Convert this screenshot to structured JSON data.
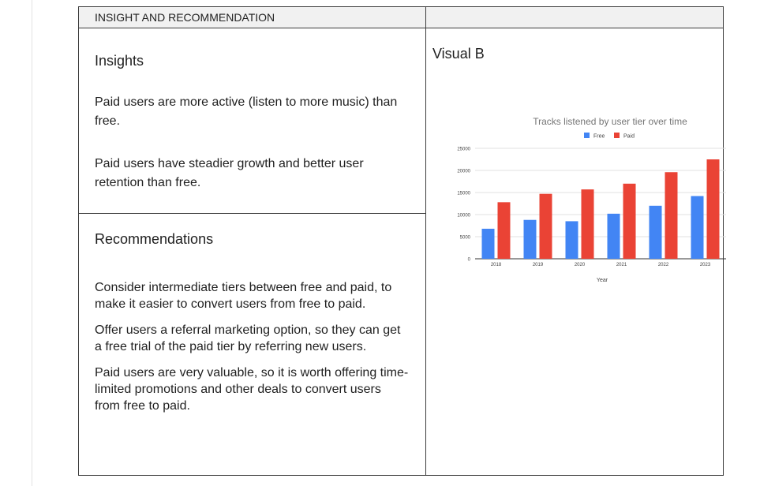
{
  "table": {
    "header_left": "INSIGHT AND RECOMMENDATION",
    "header_right": ""
  },
  "insights": {
    "title": "Insights",
    "items": [
      "Paid users are more active (listen to more music) than free.",
      "Paid users have steadier growth and better user retention than free."
    ]
  },
  "recommendations": {
    "title": "Recommendations",
    "items": [
      "Consider intermediate tiers between free and paid, to make it easier to convert users from free to paid.",
      "Offer users a referral marketing option, so they can get a free trial of the paid tier by referring new users.",
      "Paid users are very valuable, so it is worth offering time-limited promotions and other deals to convert users from free to paid."
    ]
  },
  "visual": {
    "title": "Visual B"
  },
  "colors": {
    "free": "#4285f4",
    "paid": "#ea4335"
  },
  "chart_data": {
    "type": "bar",
    "title": "Tracks listened by user tier over time",
    "xlabel": "Year",
    "ylabel": "",
    "categories": [
      "2018",
      "2019",
      "2020",
      "2021",
      "2022",
      "2023"
    ],
    "series": [
      {
        "name": "Free",
        "values": [
          6800,
          8800,
          8500,
          10200,
          12000,
          14200
        ]
      },
      {
        "name": "Paid",
        "values": [
          12800,
          14700,
          15700,
          17000,
          19600,
          22500
        ]
      }
    ],
    "ylim": [
      0,
      25000
    ],
    "yticks": [
      "0",
      "5000",
      "10000",
      "15000",
      "20000",
      "25000"
    ],
    "legend": "top-center",
    "grid": true
  }
}
